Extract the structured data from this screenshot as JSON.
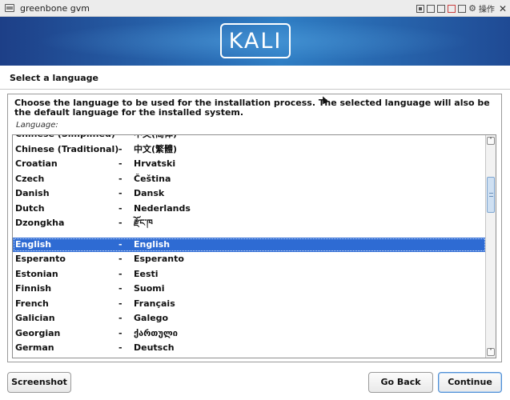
{
  "window": {
    "title": "greenbone gvm",
    "controls_label": "操作"
  },
  "banner": {
    "logo_text": "KALI"
  },
  "page": {
    "heading": "Select a language",
    "description": "Choose the language to be used for the installation process. The selected language will also be the default language for the installed system.",
    "field_label": "Language:"
  },
  "language_list": {
    "selected": "English",
    "rows": [
      {
        "name": "Chinese (Simplified)",
        "sep": "-",
        "native": "中文(简体)"
      },
      {
        "name": "Chinese (Traditional)",
        "sep": "-",
        "native": "中文(繁體)"
      },
      {
        "name": "Croatian",
        "sep": "-",
        "native": "Hrvatski"
      },
      {
        "name": "Czech",
        "sep": "-",
        "native": "Čeština"
      },
      {
        "name": "Danish",
        "sep": "-",
        "native": "Dansk"
      },
      {
        "name": "Dutch",
        "sep": "-",
        "native": "Nederlands"
      },
      {
        "name": "Dzongkha",
        "sep": "-",
        "native": "རྫོང་ཁ"
      },
      {
        "name": "English",
        "sep": "-",
        "native": "English"
      },
      {
        "name": "Esperanto",
        "sep": "-",
        "native": "Esperanto"
      },
      {
        "name": "Estonian",
        "sep": "-",
        "native": "Eesti"
      },
      {
        "name": "Finnish",
        "sep": "-",
        "native": "Suomi"
      },
      {
        "name": "French",
        "sep": "-",
        "native": "Français"
      },
      {
        "name": "Galician",
        "sep": "-",
        "native": "Galego"
      },
      {
        "name": "Georgian",
        "sep": "-",
        "native": "ქართული"
      },
      {
        "name": "German",
        "sep": "-",
        "native": "Deutsch"
      }
    ]
  },
  "buttons": {
    "screenshot": "Screenshot",
    "go_back": "Go Back",
    "continue": "Continue"
  }
}
